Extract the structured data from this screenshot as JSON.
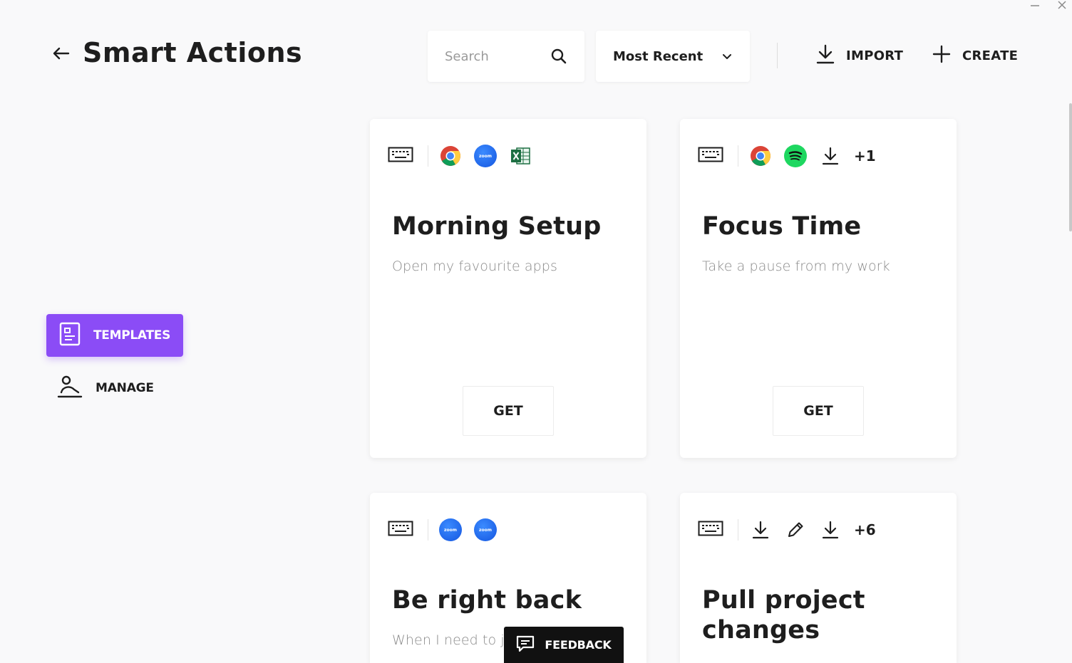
{
  "window": {
    "minimize_icon": "minimize-icon",
    "close_icon": "close-icon"
  },
  "header": {
    "title": "Smart Actions",
    "search": {
      "placeholder": "Search",
      "value": ""
    },
    "sort": {
      "selected": "Most Recent"
    },
    "import_label": "IMPORT",
    "create_label": "CREATE"
  },
  "sidebar": {
    "items": [
      {
        "label": "TEMPLATES",
        "active": true,
        "icon": "template-icon"
      },
      {
        "label": "MANAGE",
        "active": false,
        "icon": "manage-user-icon"
      }
    ]
  },
  "colors": {
    "accent": "#8b4cf6",
    "background": "#f9f9fa",
    "card": "#ffffff",
    "text": "#1e1e1e",
    "muted": "#8a8a8a"
  },
  "cards": [
    {
      "title": "Morning Setup",
      "description": "Open my favourite apps",
      "apps": [
        "chrome-icon",
        "zoom-icon",
        "excel-icon"
      ],
      "zoom_text": "zoom",
      "extra": "",
      "button": "GET"
    },
    {
      "title": "Focus Time",
      "description": "Take a pause from my work",
      "apps": [
        "chrome-icon",
        "spotify-icon",
        "download-icon"
      ],
      "extra": "+1",
      "button": "GET"
    },
    {
      "title": "Be right back",
      "description": "When I need to j",
      "apps": [
        "zoom-icon",
        "zoom-icon"
      ],
      "zoom_text": "zoom",
      "extra": ""
    },
    {
      "title": "Pull project changes",
      "description": "",
      "apps": [
        "download-icon",
        "pencil-icon",
        "download-icon"
      ],
      "extra": "+6"
    }
  ],
  "feedback": {
    "label": "FEEDBACK"
  }
}
